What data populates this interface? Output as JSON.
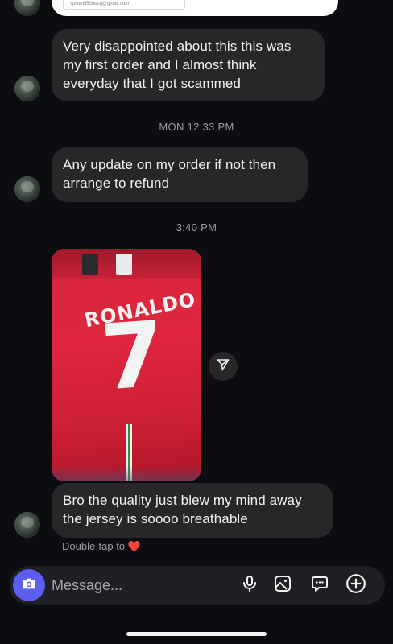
{
  "thread": {
    "top_card_email": "spiketiff50dezg@gmail.com",
    "messages": [
      {
        "lines": [
          "Very disappointed about this this was",
          "my first order and I almost think",
          "everyday that I got scammed"
        ]
      },
      {
        "lines": [
          "Any update on my order if not then",
          "arrange to refund"
        ]
      },
      {
        "lines": [
          "Bro the quality just blew my mind away",
          "the jersey is soooo breathable"
        ]
      }
    ],
    "timestamps": [
      "MON 12:33 PM",
      "3:40 PM"
    ],
    "photo": {
      "name_text": "RONALDO",
      "number_text": "7"
    },
    "reaction_hint": "Double-tap to",
    "reaction_emoji": "❤️"
  },
  "composer": {
    "placeholder": "Message...",
    "icons": [
      "camera-icon",
      "microphone-icon",
      "gallery-icon",
      "sticker-icon",
      "add-icon"
    ]
  },
  "colors": {
    "background": "#0c0d10",
    "bubble": "#262729",
    "camera_accent": "#5b5ef0",
    "jersey_red": "#e0273f"
  }
}
